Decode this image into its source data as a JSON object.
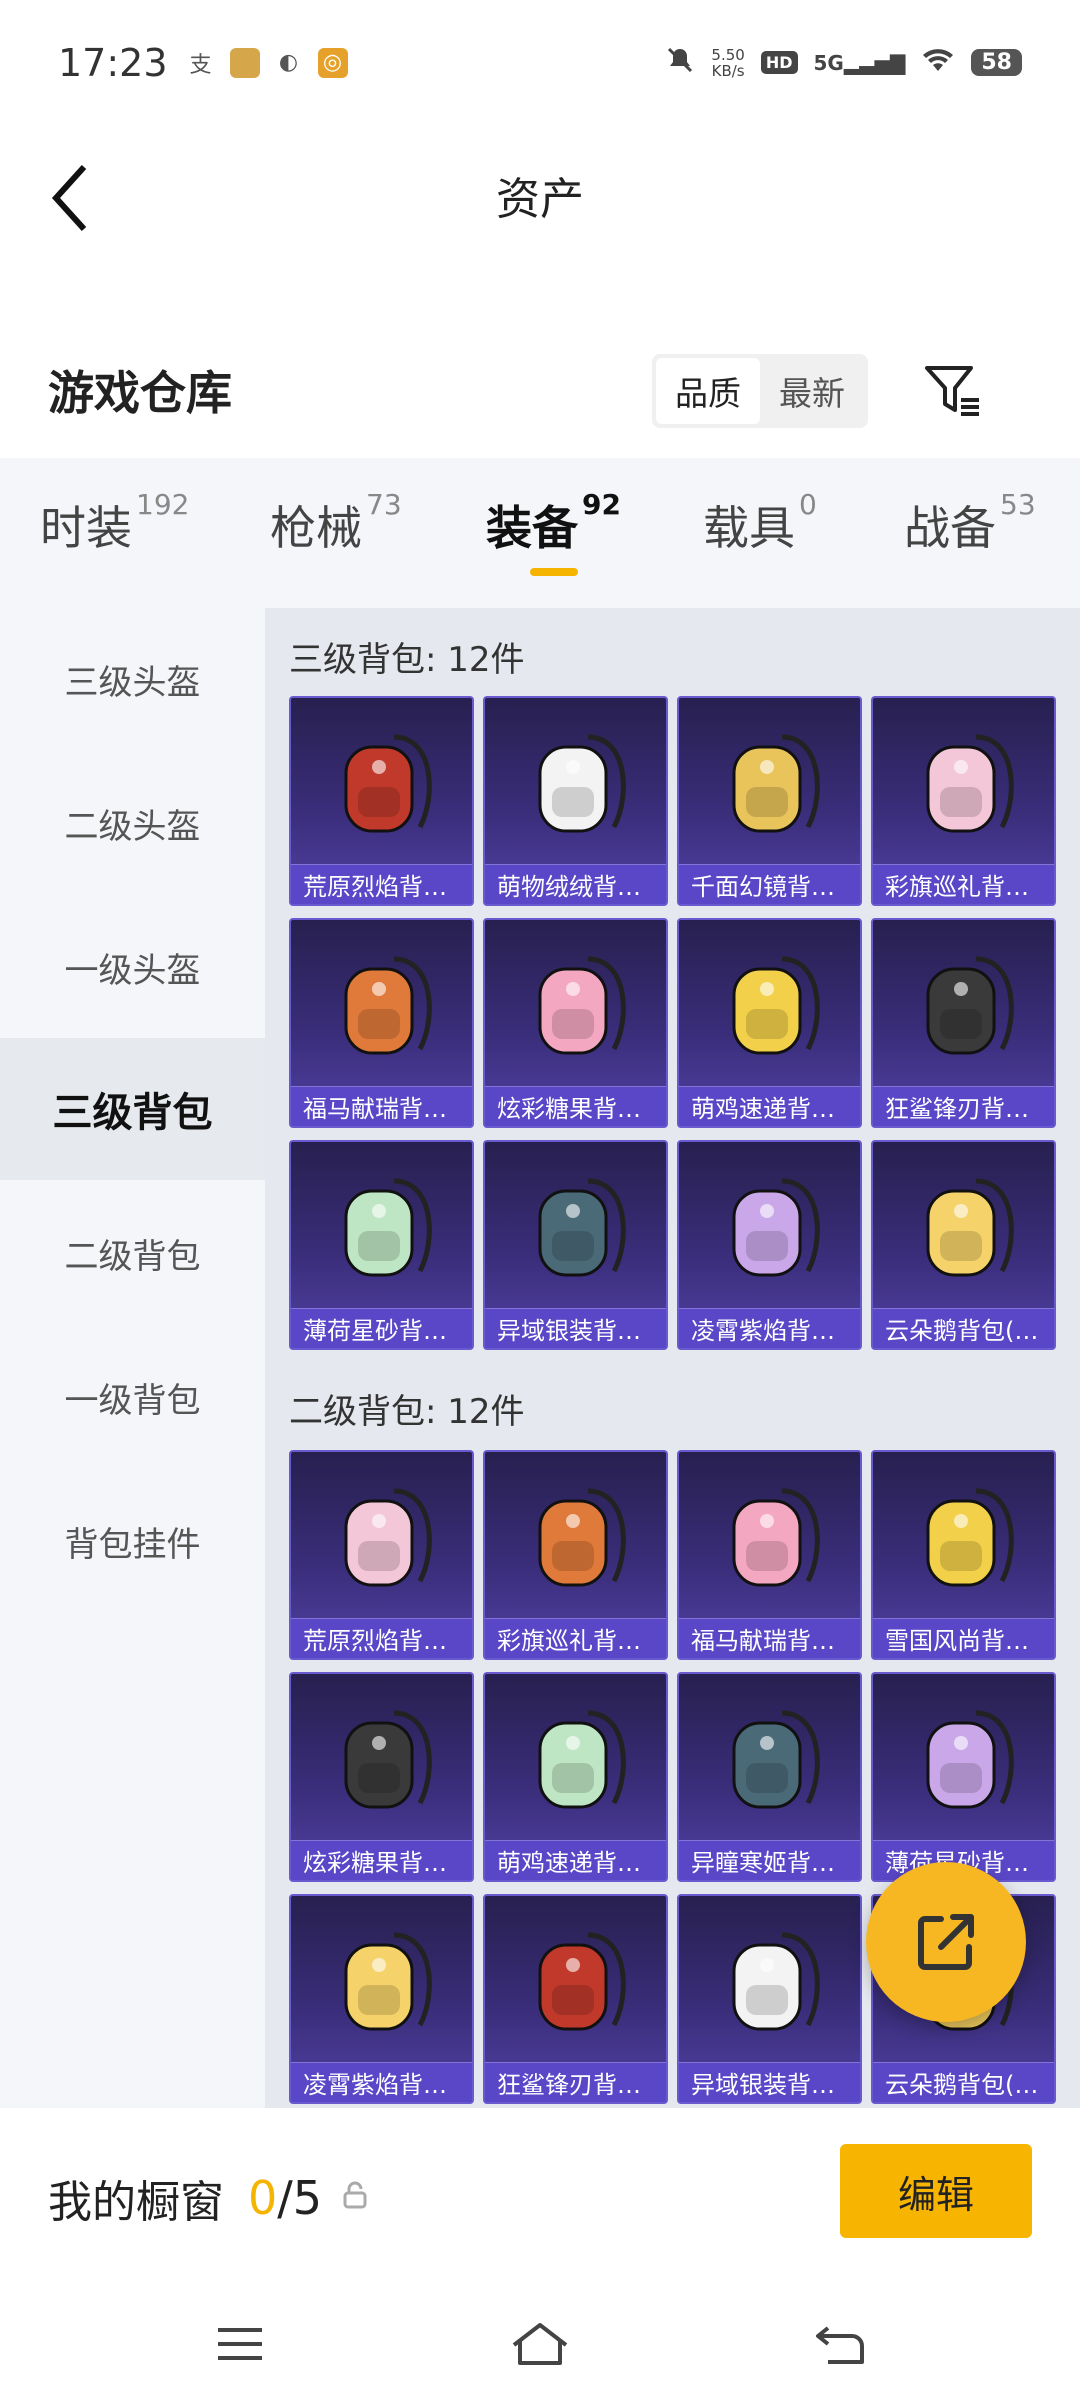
{
  "status_bar": {
    "time": "17:23",
    "app_icons": [
      "alipay-icon",
      "game-icon",
      "browser-icon",
      "app-icon"
    ],
    "net_rate_value": "5.50",
    "net_rate_unit": "KB/s",
    "hd": "HD",
    "signal": "5G",
    "battery": "58"
  },
  "header": {
    "title": "资产"
  },
  "warehouse": {
    "title": "游戏仓库",
    "sort_options": [
      "品质",
      "最新"
    ],
    "sort_selected": "品质"
  },
  "tabs": [
    {
      "label": "时装",
      "count": "192"
    },
    {
      "label": "枪械",
      "count": "73"
    },
    {
      "label": "装备",
      "count": "92"
    },
    {
      "label": "载具",
      "count": "0"
    },
    {
      "label": "战备",
      "count": "53"
    }
  ],
  "active_tab": "装备",
  "sidebar": {
    "items": [
      "三级头盔",
      "二级头盔",
      "一级头盔",
      "三级背包",
      "二级背包",
      "一级背包",
      "背包挂件"
    ],
    "active": "三级背包"
  },
  "sections": [
    {
      "title": "三级背包: 12件",
      "items": [
        "荒原烈焰背…",
        "萌物绒绒背…",
        "千面幻镜背…",
        "彩旗巡礼背…",
        "福马献瑞背…",
        "炫彩糖果背…",
        "萌鸡速递背…",
        "狂鲨锋刃背…",
        "薄荷星砂背…",
        "异域银装背…",
        "凌霄紫焰背…",
        "云朵鹅背包(…"
      ]
    },
    {
      "title": "二级背包: 12件",
      "items": [
        "荒原烈焰背…",
        "彩旗巡礼背…",
        "福马献瑞背…",
        "雪国风尚背…",
        "炫彩糖果背…",
        "萌鸡速递背…",
        "异瞳寒姬背…",
        "薄荷星砂背…",
        "凌霄紫焰背…",
        "狂鲨锋刃背…",
        "异域银装背…",
        "云朵鹅背包(…"
      ]
    }
  ],
  "bottom_bar": {
    "label": "我的橱窗",
    "current": "0",
    "total": "/5",
    "edit_label": "编辑"
  },
  "colors": {
    "accent": "#f5b400",
    "card_top": "#27204f",
    "card_bottom": "#5241a5",
    "card_label": "#5a47c8"
  }
}
